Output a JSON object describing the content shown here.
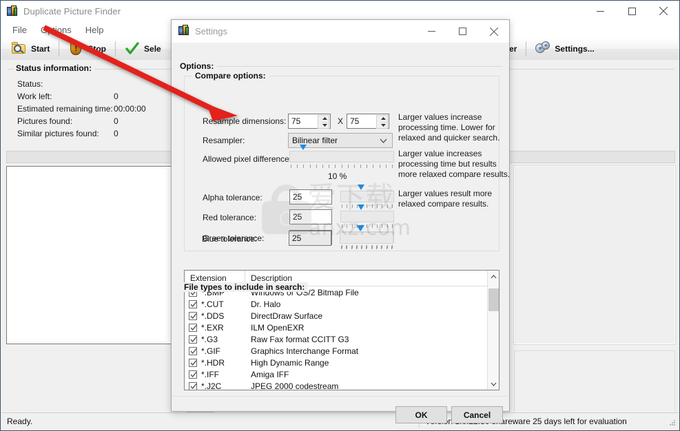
{
  "main_window": {
    "title": "Duplicate Picture Finder",
    "icon": "app-icon",
    "window_controls": {
      "minimize": "minimize-icon",
      "maximize": "maximize-icon",
      "close": "close-icon"
    },
    "menu": [
      {
        "label": "File"
      },
      {
        "label": "Options"
      },
      {
        "label": "Help"
      }
    ],
    "toolbar": [
      {
        "label": "Start",
        "icon": "folder-search-icon"
      },
      {
        "label": "Stop",
        "icon": "shield-warning-icon"
      },
      {
        "label": "Sele",
        "icon": "green-check-icon"
      },
      {
        "label": "der",
        "icon": "folder-icon"
      },
      {
        "label": "Settings...",
        "icon": "gears-icon"
      }
    ],
    "status_group": {
      "legend": "Status information:",
      "rows": [
        {
          "key": "Status:",
          "value": ""
        },
        {
          "key": "Work left:",
          "value": "0"
        },
        {
          "key": "Estimated remaining time:",
          "value": "00:00:00"
        },
        {
          "key": "Pictures found:",
          "value": "0"
        },
        {
          "key": "Similar pictures found:",
          "value": "0"
        }
      ]
    },
    "statusbar": {
      "left": "Ready.",
      "right": "Version 1.0.22.30 shareware 25 days left for evaluation"
    }
  },
  "dialog": {
    "title": "Settings",
    "icon": "app-icon",
    "window_controls": {
      "minimize": "minimize-icon",
      "maximize": "maximize-icon",
      "close": "close-icon"
    },
    "options_legend": "Options:",
    "compare": {
      "legend": "Compare options:",
      "resample_label": "Resample dimensions:",
      "resample_width": "75",
      "resample_height": "75",
      "resample_x": "X",
      "resampler_label": "Resampler:",
      "resampler_value": "Bilinear filter",
      "resampler_options": [
        "Bilinear filter"
      ],
      "pixel_diff_label": "Allowed pixel difference:",
      "pixel_diff_value": "10 %",
      "pixel_diff_percent": 10,
      "hint_resample": "Larger values increase processing time. Lower for relaxed and quicker search.",
      "hint_pixel": "Larger value increases processing time but results more relaxed compare results.",
      "hint_tolerance": "Larger values result more relaxed compare results.",
      "tolerances": [
        {
          "label": "Alpha tolerance:",
          "value": "25",
          "percent": 25
        },
        {
          "label": "Red tolerance:",
          "value": "25",
          "percent": 25
        },
        {
          "label": "Green tolerance:",
          "value": "25",
          "percent": 25
        },
        {
          "label": "Blue tolerance:",
          "value": "25",
          "percent": 25
        }
      ]
    },
    "file_types": {
      "legend": "File types to include in search:",
      "columns": [
        "Extension",
        "Description"
      ],
      "rows": [
        {
          "checked": true,
          "ext": "*.BMP",
          "desc": "Windows or OS/2 Bitmap File"
        },
        {
          "checked": true,
          "ext": "*.CUT",
          "desc": "Dr. Halo"
        },
        {
          "checked": true,
          "ext": "*.DDS",
          "desc": "DirectDraw Surface"
        },
        {
          "checked": true,
          "ext": "*.EXR",
          "desc": "ILM OpenEXR"
        },
        {
          "checked": true,
          "ext": "*.G3",
          "desc": "Raw Fax format CCITT G3"
        },
        {
          "checked": true,
          "ext": "*.GIF",
          "desc": "Graphics Interchange Format"
        },
        {
          "checked": true,
          "ext": "*.HDR",
          "desc": "High Dynamic Range"
        },
        {
          "checked": true,
          "ext": "*.IFF",
          "desc": "Amiga IFF"
        },
        {
          "checked": true,
          "ext": "*.J2C",
          "desc": "JPEG 2000 codestream"
        }
      ]
    },
    "buttons": {
      "ok": "OK",
      "cancel": "Cancel"
    }
  },
  "watermark": {
    "domain": "anxz.com",
    "chinese": "爱下载"
  },
  "colors": {
    "accent_blue": "#1f8ae0",
    "window_border": "#3b5166",
    "dialog_bg": "#f0f0f0",
    "annotation_red": "#e2231a"
  }
}
